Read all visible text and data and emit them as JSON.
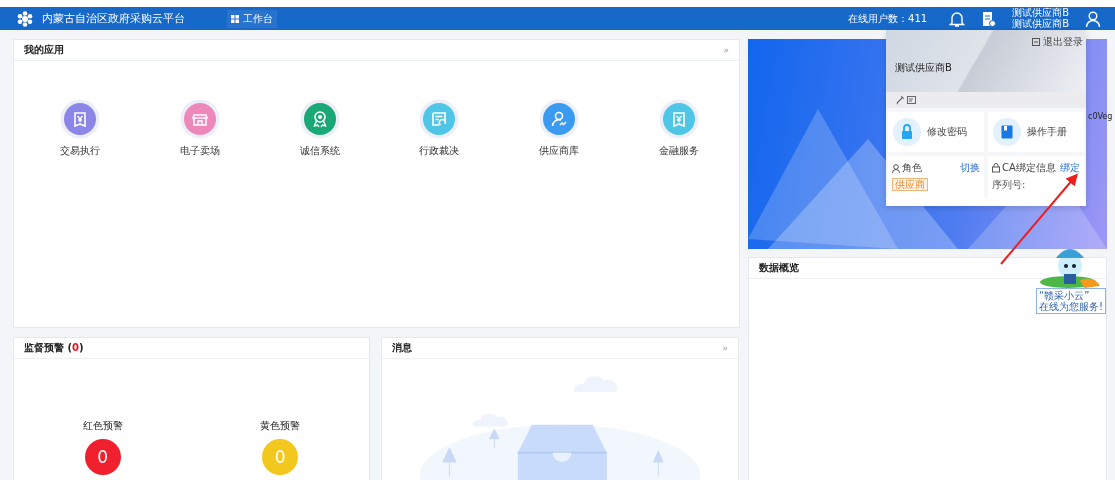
{
  "header": {
    "title": "内蒙古自治区政府采购云平台",
    "nav": [
      {
        "label": "工作台",
        "selected": true
      }
    ],
    "online_users": "在线用户数：411",
    "user_lines": [
      "测试供应商B",
      "测试供应商B"
    ]
  },
  "apps": {
    "title": "我的应用",
    "more": "»",
    "items": [
      {
        "label": "交易执行",
        "kind": "receipt",
        "color": "#8b86e8"
      },
      {
        "label": "电子卖场",
        "kind": "shop",
        "color": "#ee88bb"
      },
      {
        "label": "诚信系统",
        "kind": "award",
        "color": "#1aa876"
      },
      {
        "label": "行政裁决",
        "kind": "document",
        "color": "#4fc6e6"
      },
      {
        "label": "供应商库",
        "kind": "user",
        "color": "#3b9bf0"
      },
      {
        "label": "金融服务",
        "kind": "receipt",
        "color": "#4fc6e6"
      }
    ]
  },
  "warning": {
    "title": "监督预警",
    "count_open": "(",
    "count": "0",
    "count_close": ")",
    "items": [
      {
        "label": "红色预警",
        "value": "0",
        "color": "#f0202e"
      },
      {
        "label": "黄色预警",
        "value": "0",
        "color": "#f2c81e"
      }
    ]
  },
  "messages": {
    "title": "消息",
    "more": "»"
  },
  "banner": {
    "fragment": "c0Veg"
  },
  "overview": {
    "title": "数据概览"
  },
  "user_menu": {
    "logout": "退出登录",
    "name": "测试供应商B",
    "actions": [
      {
        "label": "修改密码",
        "kind": "lock"
      },
      {
        "label": "操作手册",
        "kind": "book"
      }
    ],
    "role": {
      "label": "角色",
      "switch": "切换",
      "tag": "供应商"
    },
    "ca": {
      "label": "CA绑定信息",
      "bind": "绑定",
      "serial": "序列号:"
    }
  },
  "assistant": {
    "lines": [
      "“赣采小云”",
      "在线为您服务!"
    ]
  }
}
